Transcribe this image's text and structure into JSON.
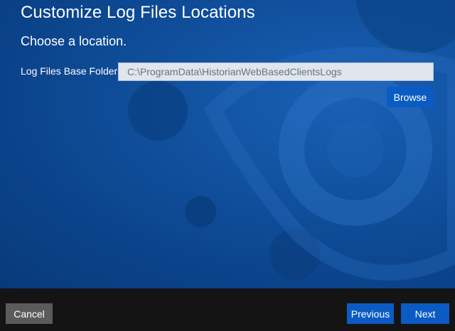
{
  "window": {
    "title": "Customize Log Files Locations",
    "subtitle": "Choose a location."
  },
  "form": {
    "base_folder_label": "Log Files Base Folder:",
    "base_folder_value": "C:\\ProgramData\\HistorianWebBasedClientsLogs",
    "browse_label": "Browse"
  },
  "footer": {
    "cancel_label": "Cancel",
    "previous_label": "Previous",
    "next_label": "Next"
  },
  "colors": {
    "background": "#0b4690",
    "primary_button": "#0a5cc3",
    "secondary_button": "#5b5b5b",
    "footer": "#141414",
    "input_background": "#dfe6ee"
  }
}
